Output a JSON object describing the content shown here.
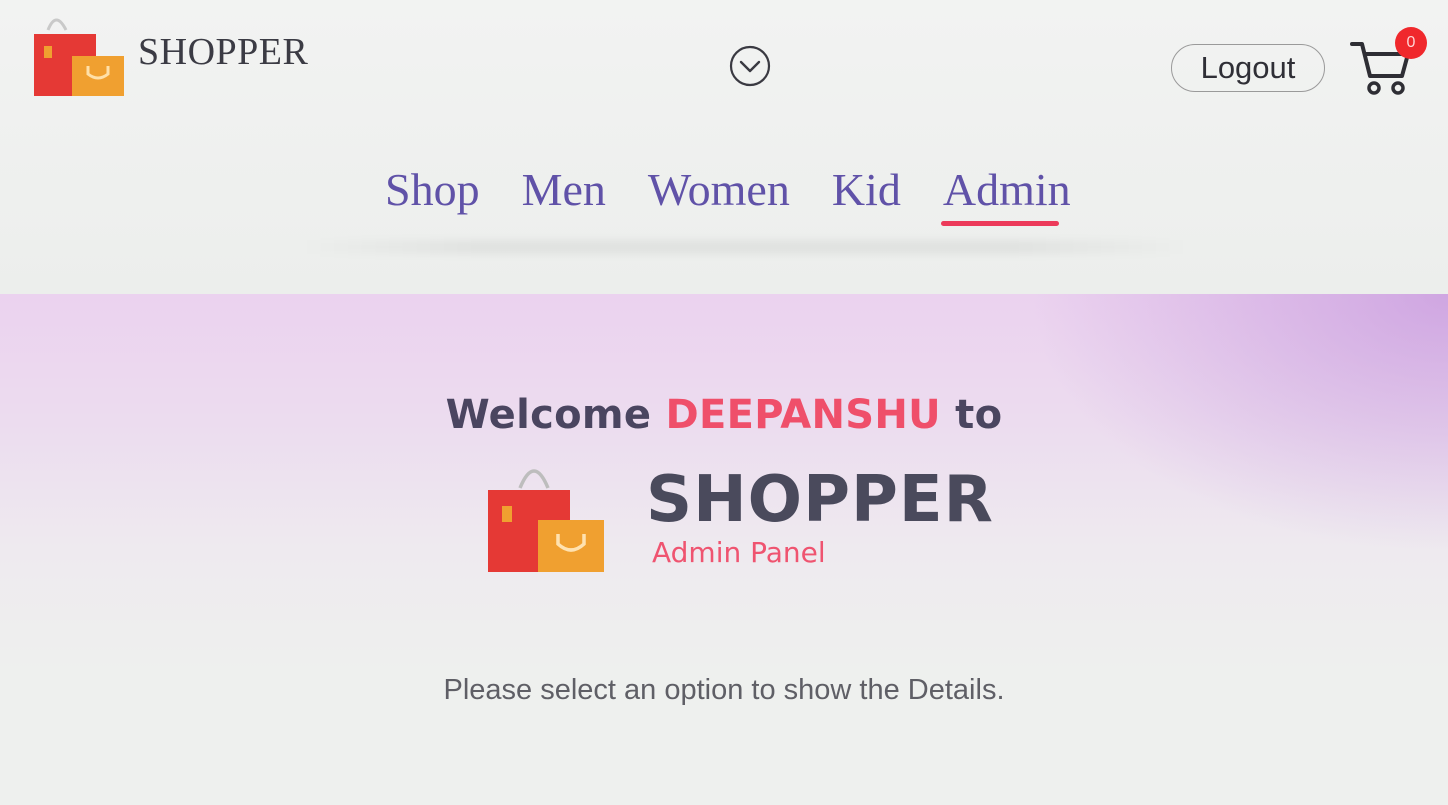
{
  "header": {
    "brand_name": "SHOPPER",
    "logout_label": "Logout",
    "cart_count": "0",
    "icons": [
      "shopping-bag-logo",
      "chevron-down-circle-icon",
      "cart-icon"
    ]
  },
  "nav": {
    "items": [
      {
        "label": "Shop",
        "active": false
      },
      {
        "label": "Men",
        "active": false
      },
      {
        "label": "Women",
        "active": false
      },
      {
        "label": "Kid",
        "active": false
      },
      {
        "label": "Admin",
        "active": true
      }
    ]
  },
  "hero": {
    "welcome_prefix": "Welcome",
    "username": "DEEPANSHU",
    "welcome_suffix": "to",
    "brand_name": "SHOPPER",
    "subtitle": "Admin Panel",
    "hint": "Please select an option to show the Details."
  },
  "colors": {
    "nav_text": "#6052a8",
    "accent_red": "#ef4f6a",
    "badge_red": "#f0282c",
    "bag_red": "#e53935",
    "bag_orange": "#f0a030",
    "hero_gradient_top": "#ebd2ef"
  }
}
